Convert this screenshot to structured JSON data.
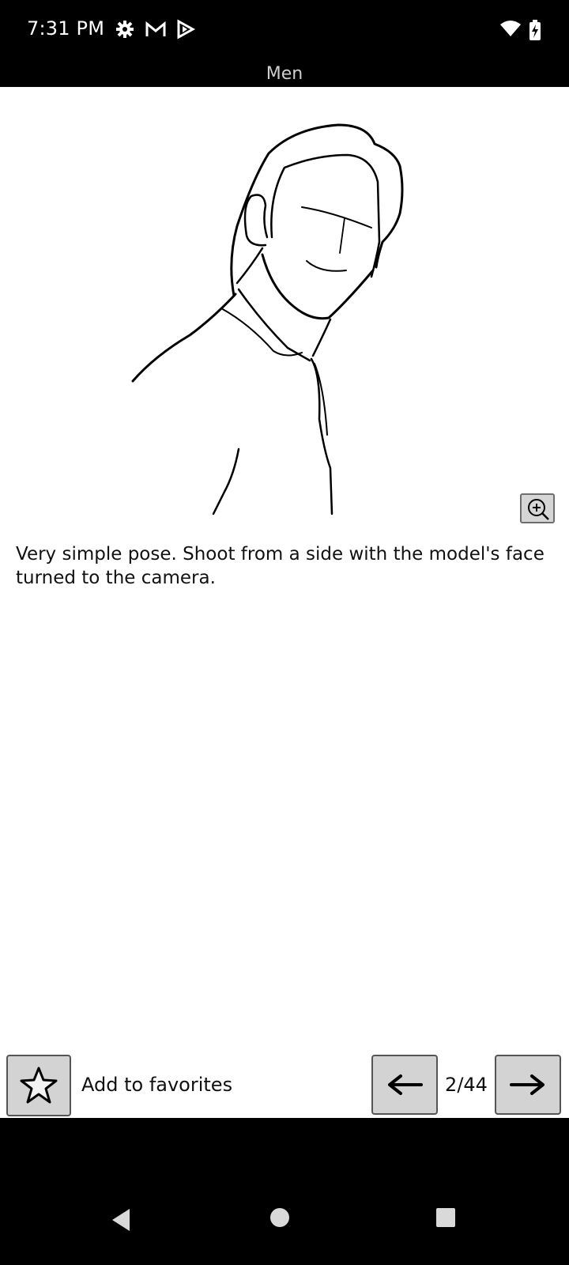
{
  "status_bar": {
    "time": "7:31 PM",
    "icons_left": [
      "gear-icon",
      "gmail-icon",
      "play-store-icon"
    ],
    "icons_right": [
      "wifi-icon",
      "battery-charging-icon"
    ]
  },
  "header": {
    "title": "Men"
  },
  "pose": {
    "description": "Very simple pose. Shoot from a side with the model's face turned to the camera."
  },
  "toolbar": {
    "favorites_label": "Add to favorites",
    "page_counter": "2/44"
  },
  "colors": {
    "background": "#ffffff",
    "bars": "#000000",
    "button_fill": "#d3d3d3"
  }
}
